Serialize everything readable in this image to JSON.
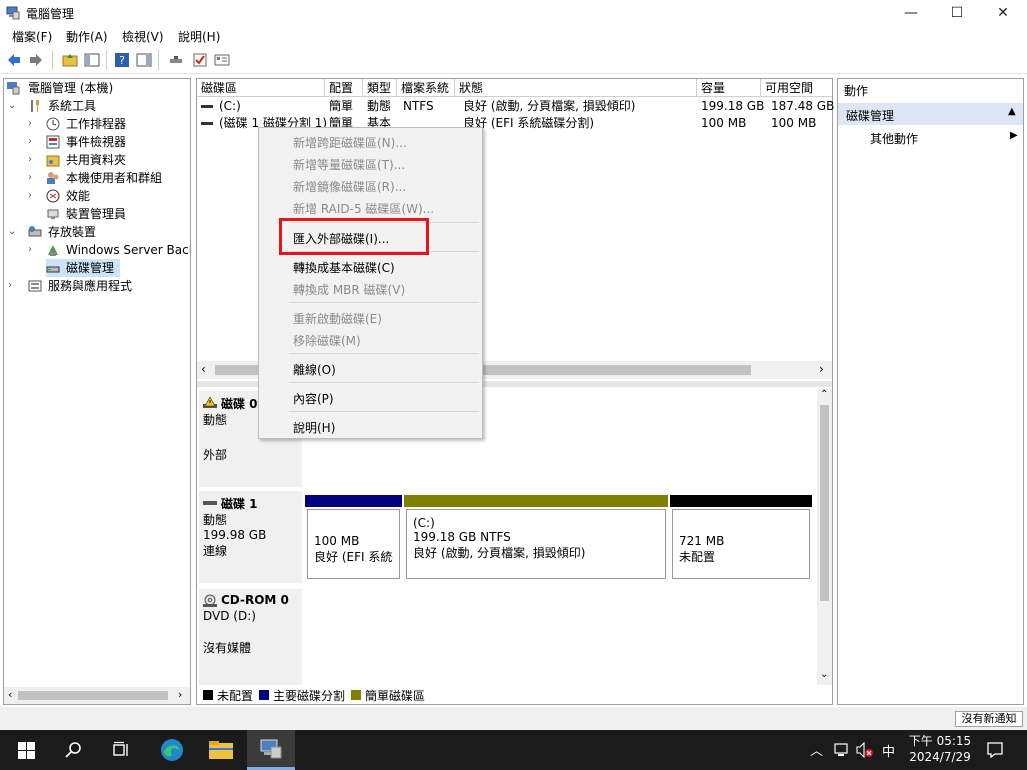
{
  "window": {
    "title": "電腦管理",
    "minimize": "—",
    "maximize": "☐",
    "close": "✕"
  },
  "menu": [
    "檔案(F)",
    "動作(A)",
    "檢視(V)",
    "說明(H)"
  ],
  "tree": [
    {
      "label": "電腦管理 (本機)"
    },
    {
      "label": "系統工具"
    },
    {
      "label": "工作排程器"
    },
    {
      "label": "事件檢視器"
    },
    {
      "label": "共用資料夾"
    },
    {
      "label": "本機使用者和群組"
    },
    {
      "label": "效能"
    },
    {
      "label": "裝置管理員"
    },
    {
      "label": "存放裝置"
    },
    {
      "label": "Windows Server Backu"
    },
    {
      "label": "磁碟管理"
    },
    {
      "label": "服務與應用程式"
    }
  ],
  "volumes": {
    "headers": [
      "磁碟區",
      "配置",
      "類型",
      "檔案系統",
      "狀態",
      "容量",
      "可用空間"
    ],
    "rows": [
      [
        "(C:)",
        "簡單",
        "動態",
        "NTFS",
        "良好 (啟動, 分頁檔案, 損毀傾印)",
        "199.18 GB",
        "187.48 GB"
      ],
      [
        "(磁碟 1 磁碟分割 1)",
        "簡單",
        "基本",
        "",
        "良好 (EFI 系統磁碟分割)",
        "100 MB",
        "100 MB"
      ]
    ]
  },
  "disks": {
    "disk0": {
      "name": "磁碟 0",
      "type": "動態",
      "status": "外部"
    },
    "disk1": {
      "name": "磁碟 1",
      "type": "動態",
      "size": "199.98 GB",
      "status": "連線",
      "parts": [
        {
          "size": "100 MB",
          "desc": "良好 (EFI 系統磁"
        },
        {
          "title": "(C:)",
          "size": "199.18 GB NTFS",
          "desc": "良好 (啟動, 分頁檔案, 損毀傾印)"
        },
        {
          "size": "721 MB",
          "desc": "未配置"
        }
      ]
    },
    "cdrom": {
      "name": "CD-ROM 0",
      "type": "DVD (D:)",
      "status": "沒有媒體"
    }
  },
  "legend": [
    "未配置",
    "主要磁碟分割",
    "簡單磁碟區"
  ],
  "colors": {
    "unallocated": "#000000",
    "primary": "#000080",
    "simple": "#808000",
    "highlight_border": "#e8141c"
  },
  "actions": {
    "header": "動作",
    "section": "磁碟管理",
    "more": "其他動作"
  },
  "context_menu": {
    "items": [
      {
        "label": "新增跨距磁碟區(N)...",
        "disabled": true
      },
      {
        "label": "新增等量磁碟區(T)...",
        "disabled": true
      },
      {
        "label": "新增鏡像磁碟區(R)...",
        "disabled": true
      },
      {
        "label": "新增 RAID-5 磁碟區(W)...",
        "disabled": true
      },
      {
        "label": "匯入外部磁碟(I)...",
        "disabled": false
      },
      {
        "label": "轉換成基本磁碟(C)",
        "disabled": false
      },
      {
        "label": "轉換成 MBR 磁碟(V)",
        "disabled": true
      },
      {
        "label": "重新啟動磁碟(E)",
        "disabled": true
      },
      {
        "label": "移除磁碟(M)",
        "disabled": true
      },
      {
        "label": "離線(O)",
        "disabled": false
      },
      {
        "label": "內容(P)",
        "disabled": false
      },
      {
        "label": "說明(H)",
        "disabled": false
      }
    ]
  },
  "status_bar": {
    "notification": "沒有新通知"
  },
  "taskbar": {
    "time": "下午 05:15",
    "date": "2024/7/29",
    "ime": "中"
  }
}
